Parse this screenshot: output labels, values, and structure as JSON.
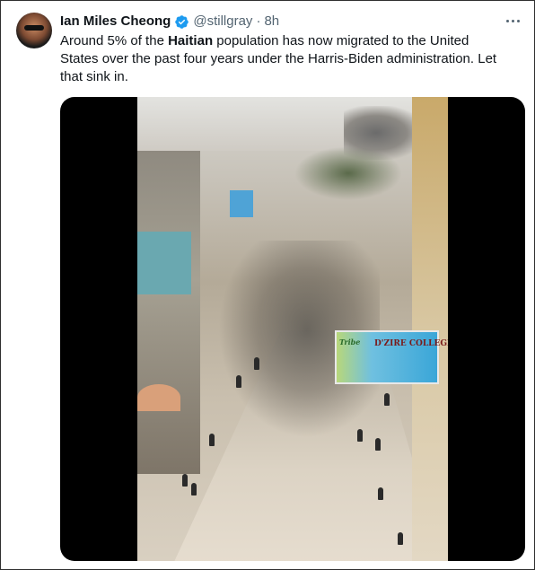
{
  "tweet": {
    "author_name": "Ian Miles Cheong",
    "handle": "@stillgray",
    "separator": "·",
    "time": "8h",
    "text_before": "Around 5% of the ",
    "text_bold": "Haitian",
    "text_after": " population has now migrated to the United States over the past four years under the Harris-Biden administration. Let that sink in."
  },
  "media": {
    "sign_text": "D'ZIRE COLLEGE",
    "sign_logo": "Tribe"
  },
  "colors": {
    "verified": "#1d9bf0",
    "secondary_text": "#536471",
    "primary_text": "#0f1419"
  },
  "icons": {
    "verified": "verified-badge-icon",
    "more": "more-dots-icon"
  }
}
